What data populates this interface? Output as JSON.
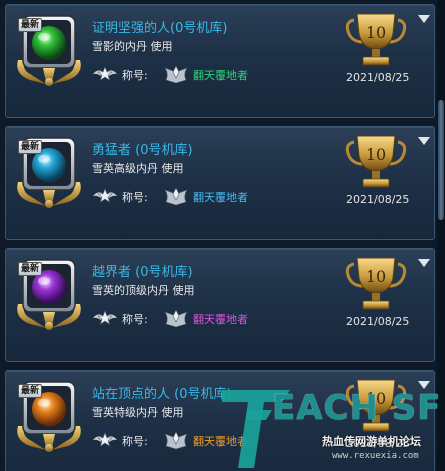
{
  "achievements": [
    {
      "badge": "最新",
      "title": "证明坚强的人(0号机库)",
      "desc": "雪影的内丹 使用",
      "title_label": "称号:",
      "title_value": "翻天覆地者",
      "title_color": "#2fd07a",
      "points": "10",
      "date": "2021/08/25",
      "orb_color": "#2fbf3a"
    },
    {
      "badge": "最新",
      "title": "勇猛者 (0号机库)",
      "desc": "雪英高级内丹 使用",
      "title_label": "称号:",
      "title_value": "翻天覆地者",
      "title_color": "#49b8f0",
      "points": "10",
      "date": "2021/08/25",
      "orb_color": "#22a8d8"
    },
    {
      "badge": "最新",
      "title": "越界者 (0号机库)",
      "desc": "雪英的顶级内丹 使用",
      "title_label": "称号:",
      "title_value": "翻天覆地者",
      "title_color": "#d457d9",
      "points": "10",
      "date": "2021/08/25",
      "orb_color": "#9b35d6"
    },
    {
      "badge": "最新",
      "title": "站在顶点的人 (0号机库)",
      "desc": "雪英特级内丹 使用",
      "title_label": "称号:",
      "title_value": "翻天覆地者",
      "title_color": "#f09a2a",
      "points": "10",
      "date": "2021/08/25",
      "orb_color": "#e8821c"
    }
  ],
  "watermark": {
    "letters": "EACH SF",
    "cn": "热血传网游单机论坛",
    "url": "www.rexuexia.com"
  }
}
